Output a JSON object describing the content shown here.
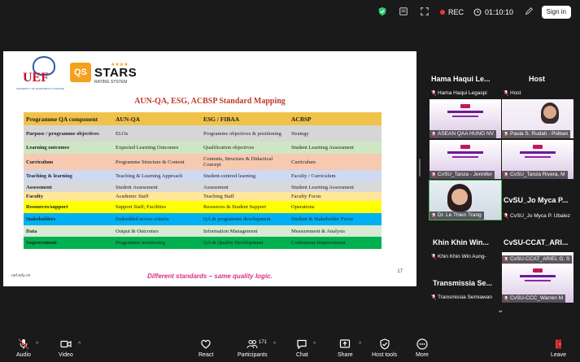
{
  "topbar": {
    "rec_label": "REC",
    "timer": "01:10:10",
    "signin_label": "Sign in"
  },
  "slide": {
    "logo_uef": "UEF",
    "logo_uef_sub": "UNIVERSITY OF ECONOMICS & FINANCE",
    "logo_qs": "QS",
    "logo_stars": "STARS",
    "logo_stars_sub": "RATING SYSTEM",
    "title": "AUN-QA, ESG, ACBSP Standard Mapping",
    "headers": [
      "Programme QA component",
      "AUN-QA",
      "ESG / FIBAA",
      "ACBSP"
    ],
    "rows": [
      {
        "cells": [
          "Purpose / programme objectives",
          "ELOs",
          "Programme objectives & positioning",
          "Strategy"
        ],
        "color": "#d6d6d6"
      },
      {
        "cells": [
          "Learning outcomes",
          "Expected Learning Outcomes",
          "Qualification objectives",
          "Student Learning Assessment"
        ],
        "color": "#cfe6c4"
      },
      {
        "cells": [
          "Curriculum",
          "Programme Structure & Content",
          "Contents, Structure & Didactical Concept",
          "Curriculum"
        ],
        "color": "#f6c9b0"
      },
      {
        "cells": [
          "Teaching & learning",
          "Teaching & Learning Approach",
          "Student-centred learning",
          "Faculty / Curriculum"
        ],
        "color": "#cfd9f0"
      },
      {
        "cells": [
          "Assessment",
          "Student Assessment",
          "Assessment",
          "Student Learning Assessment"
        ],
        "color": "#d9d9d9"
      },
      {
        "cells": [
          "Faculty",
          "Academic Staff",
          "Teaching Staff",
          "Faculty Focus"
        ],
        "color": "#ffe699"
      },
      {
        "cells": [
          "Resources/support",
          "Support Staff; Facilities",
          "Resources & Student Support",
          "Operations"
        ],
        "color": "#ffff00"
      },
      {
        "cells": [
          "Stakeholders",
          "Embedded across criteria",
          "QA & programme development",
          "Student & Stakeholder Focus"
        ],
        "color": "#00b0f0"
      },
      {
        "cells": [
          "Data",
          "Output & Outcomes",
          "Information Management",
          "Measurement & Analysis"
        ],
        "color": "#d9ead3"
      },
      {
        "cells": [
          "Improvement",
          "Programme monitoring",
          "QA & Quality Development",
          "Continuous Improvement"
        ],
        "color": "#00b050"
      }
    ],
    "url": "uef.edu.vn",
    "page_number": "17",
    "tagline": "Different standards – same quality logic."
  },
  "participants": {
    "headers": [
      {
        "label": "Hama Haqui Le...",
        "id": "h1"
      },
      {
        "label": "Host",
        "id": "h2"
      },
      {
        "label": "CvSU_Jo Myca P...",
        "id": "h3"
      },
      {
        "label": "Khin Khin Win...",
        "id": "h4"
      },
      {
        "label": "CvSU-CCAT_ARI...",
        "id": "h5"
      },
      {
        "label": "Transmissia Se...",
        "id": "h6"
      }
    ],
    "tiles": [
      {
        "name": "Hama Haqui Legaspi"
      },
      {
        "name": "Host"
      },
      {
        "name": "ASEAN QAA HUNG NV"
      },
      {
        "name": "Paula S. Rudati - Polban"
      },
      {
        "name": "CvSU_Tanza - Jennifer"
      },
      {
        "name": "CvSU_Tanza Rivera, M"
      },
      {
        "name": "Dr. Le Thien Trang"
      },
      {
        "name": "CvSU_Jo Myca P. Ubalez"
      },
      {
        "name": "Khin Khin Win Aung-"
      },
      {
        "name": "CvSU-CCAT_ARIEL G. S"
      },
      {
        "name": "Transmissia Semiawan"
      },
      {
        "name": "CvSU-CCC_Warren M"
      }
    ]
  },
  "toolbar": {
    "audio": "Audio",
    "video": "Video",
    "react": "React",
    "participants": "Participants",
    "participants_count": "171",
    "chat": "Chat",
    "share": "Share",
    "host_tools": "Host tools",
    "more": "More",
    "leave": "Leave"
  },
  "colors": {
    "accent_green": "#4caf50",
    "rec_red": "#e53935",
    "leave_red": "#e53935",
    "title_red": "#c0392b",
    "tagline_pink": "#d63384"
  }
}
